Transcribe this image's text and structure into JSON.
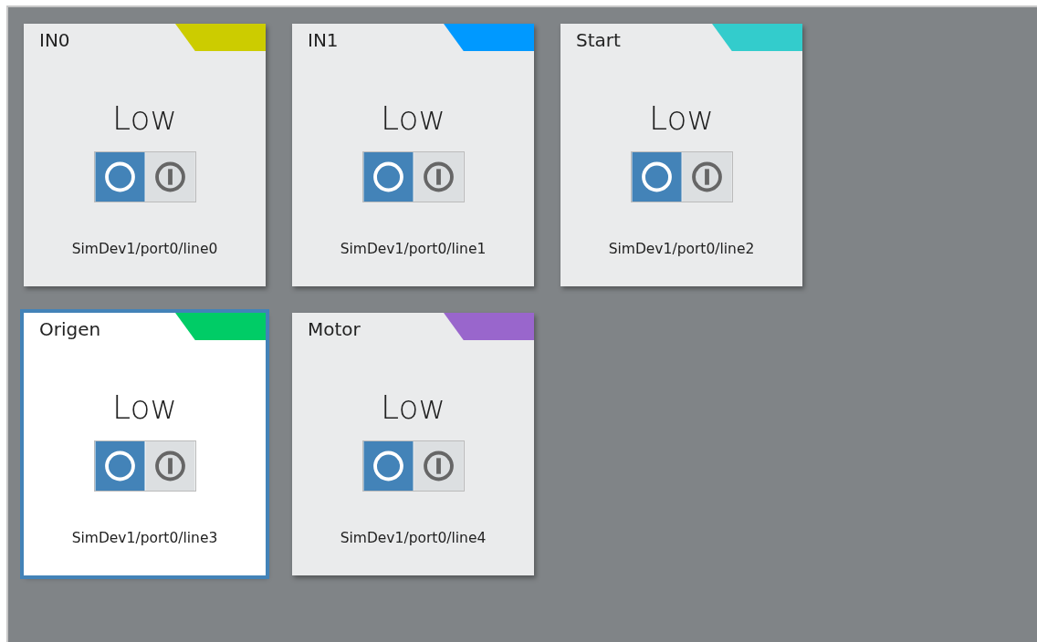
{
  "channels": [
    {
      "name": "IN0",
      "color": "#cccc00",
      "state": "Low",
      "on": false,
      "path": "SimDev1/port0/line0",
      "selected": false
    },
    {
      "name": "IN1",
      "color": "#0099ff",
      "state": "Low",
      "on": false,
      "path": "SimDev1/port0/line1",
      "selected": false
    },
    {
      "name": "Start",
      "color": "#33cccc",
      "state": "Low",
      "on": false,
      "path": "SimDev1/port0/line2",
      "selected": false
    },
    {
      "name": "Origen",
      "color": "#00cc66",
      "state": "Low",
      "on": false,
      "path": "SimDev1/port0/line3",
      "selected": true
    },
    {
      "name": "Motor",
      "color": "#9966cc",
      "state": "Low",
      "on": false,
      "path": "SimDev1/port0/line4",
      "selected": false
    }
  ]
}
